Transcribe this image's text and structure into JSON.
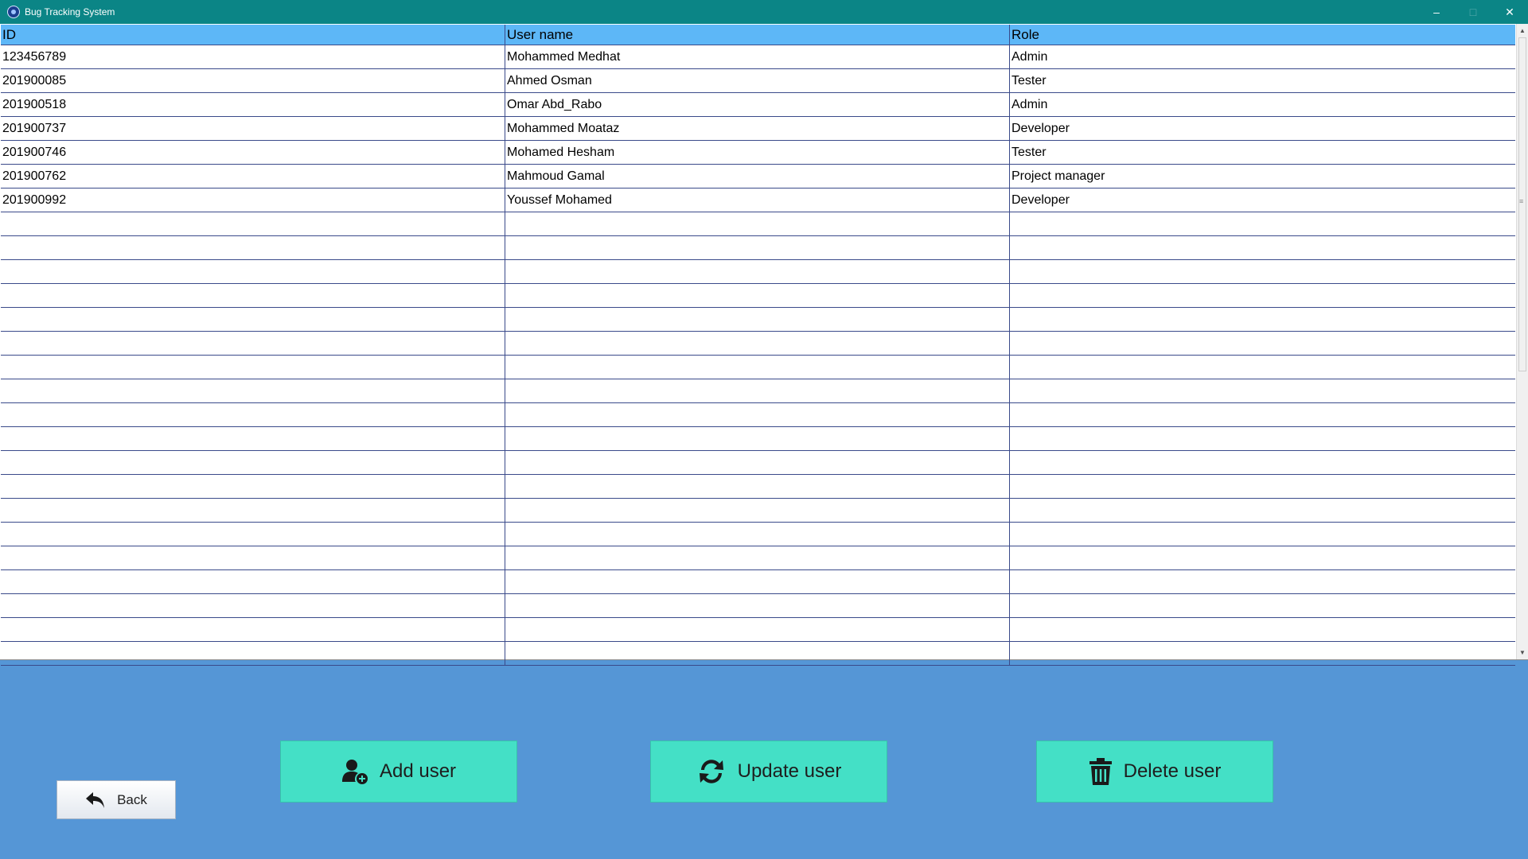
{
  "window": {
    "title": "Bug Tracking System",
    "controls": {
      "minimize": "–",
      "maximize": "□",
      "close": "✕"
    }
  },
  "table": {
    "columns": [
      "ID",
      "User name",
      "Role"
    ],
    "rows": [
      [
        "123456789",
        "Mohammed Medhat",
        "Admin"
      ],
      [
        "201900085",
        "Ahmed Osman",
        "Tester"
      ],
      [
        "201900518",
        "Omar Abd_Rabo",
        "Admin"
      ],
      [
        "201900737",
        "Mohammed Moataz",
        "Developer"
      ],
      [
        "201900746",
        "Mohamed Hesham",
        "Tester"
      ],
      [
        "201900762",
        "Mahmoud Gamal",
        "Project manager"
      ],
      [
        "201900992",
        "Youssef Mohamed",
        "Developer"
      ]
    ],
    "empty_rows": 19
  },
  "actions": {
    "add": {
      "label": "Add user",
      "icon": "add-user-icon"
    },
    "update": {
      "label": "Update user",
      "icon": "refresh-icon"
    },
    "delete": {
      "label": "Delete user",
      "icon": "trash-icon"
    },
    "back": {
      "label": "Back",
      "icon": "back-arrow-icon"
    }
  },
  "colors": {
    "titlebar": "#0b8586",
    "header": "#5db7f7",
    "background": "#5596d6",
    "action_button": "#44e0c6"
  }
}
